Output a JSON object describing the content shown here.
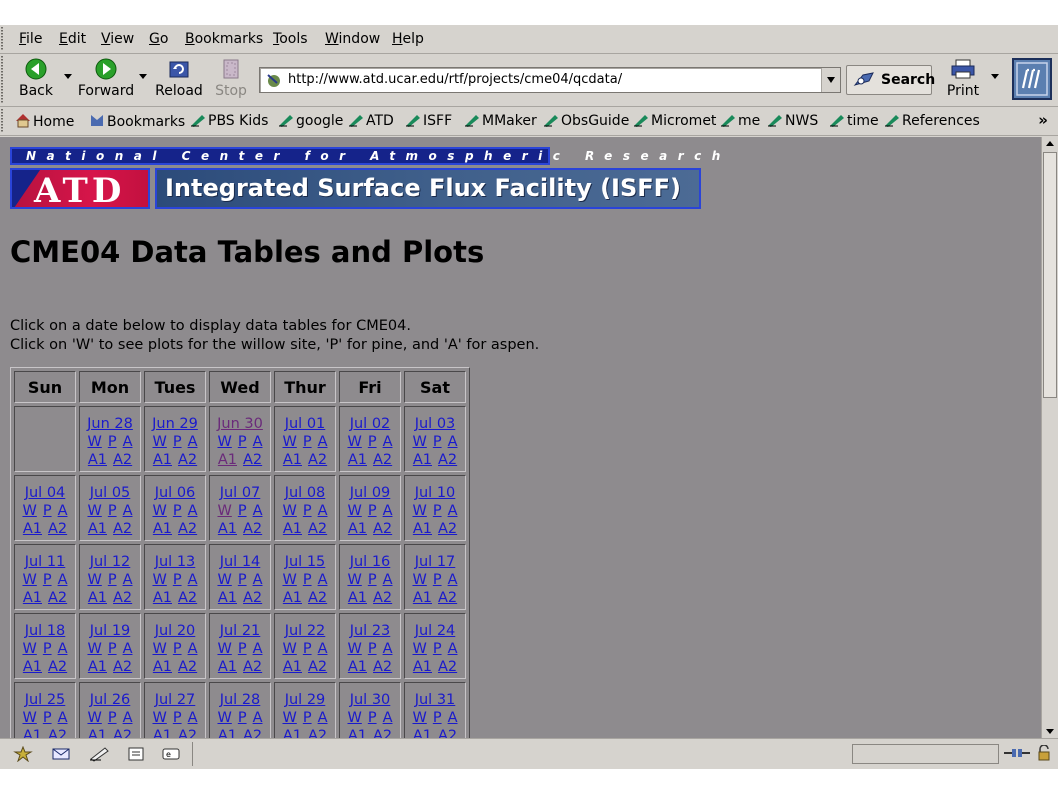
{
  "menu": [
    "File",
    "Edit",
    "View",
    "Go",
    "Bookmarks",
    "Tools",
    "Window",
    "Help"
  ],
  "nav": {
    "back": "Back",
    "forward": "Forward",
    "reload": "Reload",
    "stop": "Stop",
    "url": "http://www.atd.ucar.edu/rtf/projects/cme04/qcdata/",
    "search": "Search",
    "print": "Print"
  },
  "personal_toolbar": [
    "Home",
    "Bookmarks",
    "PBS Kids",
    "google",
    "ATD",
    "ISFF",
    "MMaker",
    "ObsGuide",
    "Micromet",
    "me",
    "NWS",
    "time",
    "References"
  ],
  "page": {
    "ncar_banner": "National Center for Atmospheric Research",
    "atd_logo": "ATD",
    "isff_banner": "Integrated Surface Flux Facility (ISFF)",
    "title": "CME04 Data Tables and Plots",
    "intro1": "Click on a date below to display data tables for CME04.",
    "intro2": "Click on 'W' to see plots for the willow site, 'P' for pine, and 'A' for aspen."
  },
  "calendar": {
    "days": [
      "Sun",
      "Mon",
      "Tues",
      "Wed",
      "Thur",
      "Fri",
      "Sat"
    ],
    "links": [
      "W",
      "P",
      "A",
      "A1",
      "A2"
    ],
    "weeks": [
      [
        "",
        "Jun 28",
        "Jun 29",
        "Jun 30",
        "Jul 01",
        "Jul 02",
        "Jul 03"
      ],
      [
        "Jul 04",
        "Jul 05",
        "Jul 06",
        "Jul 07",
        "Jul 08",
        "Jul 09",
        "Jul 10"
      ],
      [
        "Jul 11",
        "Jul 12",
        "Jul 13",
        "Jul 14",
        "Jul 15",
        "Jul 16",
        "Jul 17"
      ],
      [
        "Jul 18",
        "Jul 19",
        "Jul 20",
        "Jul 21",
        "Jul 22",
        "Jul 23",
        "Jul 24"
      ],
      [
        "Jul 25",
        "Jul 26",
        "Jul 27",
        "Jul 28",
        "Jul 29",
        "Jul 30",
        "Jul 31"
      ]
    ],
    "visited_dates": [
      "Jun 30"
    ],
    "visited_links": [
      [
        "Jun 30",
        "A1"
      ],
      [
        "Jul 07",
        "W"
      ]
    ]
  },
  "colors": {
    "page_bg": "#8e8b8e",
    "chrome": "#d6d3ce",
    "link": "#1a1acc",
    "visited": "#6a2a7a",
    "banner_blue": "#15238a"
  }
}
